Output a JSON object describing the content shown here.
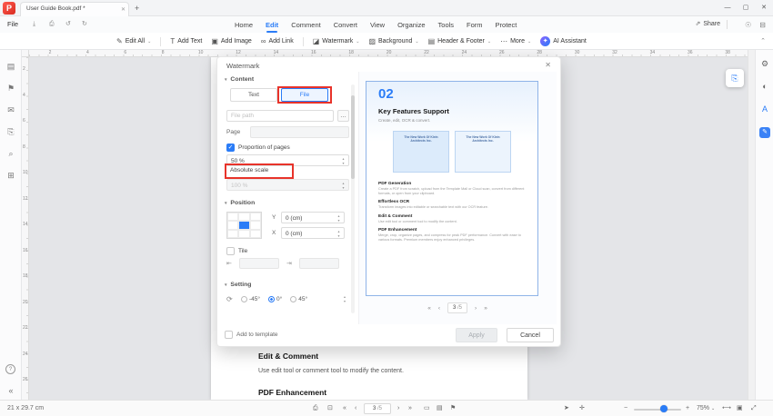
{
  "accent": "#2a7cf7",
  "ui": {
    "check_glyph": "✓",
    "spin_up": "▴",
    "spin_down": "▾",
    "section_caret": "▾"
  },
  "titlebar": {
    "logo_letter": "P",
    "tab_title": "User Guide Book.pdf *",
    "tab_close": "✕",
    "new_tab": "+",
    "minimize": "—",
    "maximize": "▢",
    "close": "✕"
  },
  "menubar": {
    "file": "File",
    "quick_icons": [
      {
        "name": "save-icon",
        "glyph": "⤓"
      },
      {
        "name": "print-icon",
        "glyph": "⎙"
      },
      {
        "name": "undo-icon",
        "glyph": "↺"
      },
      {
        "name": "redo-icon",
        "glyph": "↻"
      }
    ],
    "items": [
      {
        "label": "Home",
        "active": false
      },
      {
        "label": "Edit",
        "active": true
      },
      {
        "label": "Comment",
        "active": false
      },
      {
        "label": "Convert",
        "active": false
      },
      {
        "label": "View",
        "active": false
      },
      {
        "label": "Organize",
        "active": false
      },
      {
        "label": "Tools",
        "active": false
      },
      {
        "label": "Form",
        "active": false
      },
      {
        "label": "Protect",
        "active": false
      }
    ],
    "share_label": "Share",
    "share_icon": "⇗",
    "right_icons": [
      {
        "name": "user-icon",
        "glyph": "☉"
      },
      {
        "name": "panel-toggle-icon",
        "glyph": "⊟"
      }
    ]
  },
  "toolbar": {
    "items": [
      {
        "name": "edit-all",
        "icon": "✎",
        "label": "Edit All",
        "dropdown": true,
        "divider_after": true
      },
      {
        "name": "add-text",
        "icon": "T",
        "label": "Add Text",
        "dropdown": false
      },
      {
        "name": "add-image",
        "icon": "▣",
        "label": "Add Image",
        "dropdown": false
      },
      {
        "name": "add-link",
        "icon": "∞",
        "label": "Add Link",
        "dropdown": false,
        "divider_after": true
      },
      {
        "name": "watermark",
        "icon": "◪",
        "label": "Watermark",
        "dropdown": true
      },
      {
        "name": "background",
        "icon": "▨",
        "label": "Background",
        "dropdown": true
      },
      {
        "name": "header-footer",
        "icon": "▤",
        "label": "Header & Footer",
        "dropdown": true
      },
      {
        "name": "more",
        "icon": "⋯",
        "label": "More",
        "dropdown": true
      },
      {
        "name": "ai-assistant",
        "icon": "✦",
        "label": "AI Assistant",
        "dropdown": false,
        "accent": true
      }
    ],
    "collapse_icon": "⌃"
  },
  "ruler": {
    "h_numbers": [
      2,
      4,
      6,
      8,
      10,
      12,
      14,
      16,
      18,
      20,
      22,
      24,
      26,
      28,
      30,
      32,
      34,
      36,
      38
    ],
    "v_numbers": [
      2,
      4,
      6,
      8,
      10,
      12,
      14,
      16,
      18,
      20,
      22,
      24,
      26
    ]
  },
  "left_sidebar": {
    "icons": [
      {
        "name": "thumbnails-icon",
        "glyph": "▤"
      },
      {
        "name": "bookmarks-icon",
        "glyph": "⚑"
      },
      {
        "name": "comments-icon",
        "glyph": "✉"
      },
      {
        "name": "attachments-icon",
        "glyph": "⎘"
      },
      {
        "name": "search-icon",
        "glyph": "⌕"
      },
      {
        "name": "stamps-icon",
        "glyph": "⊞"
      }
    ],
    "help_glyph": "?",
    "collapse_glyph": "«"
  },
  "right_sidebar": {
    "icons": [
      {
        "name": "properties-icon",
        "glyph": "⚙"
      },
      {
        "name": "read-mode-icon",
        "glyph": "◐"
      },
      {
        "name": "translate-icon",
        "glyph": "A",
        "color": "#2a7cf7"
      },
      {
        "name": "ai-sidebar-icon",
        "glyph": "✎",
        "filled": true
      }
    ]
  },
  "floating_widget": {
    "glyph": "⎘"
  },
  "dialog": {
    "title": "Watermark",
    "close": "✕",
    "sections": {
      "content": "Content",
      "position": "Position",
      "setting": "Setting"
    },
    "tabs": {
      "text": "Text",
      "file": "File"
    },
    "file_path": {
      "placeholder": "File path",
      "browse": "…"
    },
    "page_label": "Page",
    "proportion": {
      "label": "Proportion of pages",
      "value": "50 %",
      "checked": true
    },
    "absolute_scale": {
      "label": "Absolute scale",
      "value": "100 %"
    },
    "position": {
      "y_label": "Y",
      "y_value": "0 (cm)",
      "x_label": "X",
      "x_value": "0 (cm)"
    },
    "tile": {
      "label": "Tile",
      "icon1": "⇤",
      "icon2": "⇥"
    },
    "setting": {
      "rotate_icon": "⟳",
      "options": [
        {
          "label": "-45°",
          "checked": false
        },
        {
          "label": "0°",
          "checked": true
        },
        {
          "label": "45°",
          "checked": false
        }
      ]
    },
    "pager": {
      "first": "«",
      "prev": "‹",
      "current": "3",
      "total": "/5",
      "next": "›",
      "last": "»"
    },
    "footer": {
      "add_to_template": "Add to template",
      "apply": "Apply",
      "cancel": "Cancel"
    }
  },
  "preview": {
    "number": "02",
    "title": "Key Features Support",
    "subtitle": "Create, edit, OCR & convert.",
    "thumbnails": [
      {
        "caption": "The New Work Of Klein Architects Inc."
      },
      {
        "caption": "The New Work Of Klein Architects Inc."
      }
    ],
    "sections": [
      {
        "heading": "PDF Generation",
        "body": "Create a PDF from scratch, upload from the Template Mall or Cloud scan, convert from different formats, or open from your clipboard."
      },
      {
        "heading": "Effortless OCR",
        "body": "Transform images into editable or searchable text with our OCR feature."
      },
      {
        "heading": "Edit & Comment",
        "body": "Use edit tool or comment tool to modify the content."
      },
      {
        "heading": "PDF Enhancement",
        "body": "Merge, crop, organize pages, and compress for peak PDF performance. Convert with ease to various formats. Premium members enjoy enhanced privileges."
      }
    ]
  },
  "document": {
    "sections": [
      {
        "heading": "Edit & Comment",
        "body": "Use edit tool or comment tool to modify the content."
      },
      {
        "heading": "PDF Enhancement",
        "body": ""
      }
    ]
  },
  "statusbar": {
    "page_size": "21 x 29.7 cm",
    "icons_left": [
      {
        "name": "print-icon",
        "glyph": "⎙"
      },
      {
        "name": "snapshot-icon",
        "glyph": "⊡"
      }
    ],
    "nav": {
      "first": "«",
      "prev": "‹",
      "current": "3",
      "total": "/5",
      "next": "›",
      "last": "»"
    },
    "icons_view": [
      {
        "name": "single-page-icon",
        "glyph": "▭"
      },
      {
        "name": "continuous-view-icon",
        "glyph": "▤"
      },
      {
        "name": "bookmark-view-icon",
        "glyph": "⚑"
      }
    ],
    "tools": [
      {
        "name": "select-tool-icon",
        "glyph": "➤"
      },
      {
        "name": "hand-tool-icon",
        "glyph": "✛"
      }
    ],
    "zoom": {
      "out": "−",
      "in": "+",
      "level": "75%",
      "caret": "⌄"
    },
    "icons_right": [
      {
        "name": "fit-width-icon",
        "glyph": "⟷"
      },
      {
        "name": "fit-page-icon",
        "glyph": "▣"
      },
      {
        "name": "fullscreen-icon",
        "glyph": "⤢"
      }
    ]
  }
}
